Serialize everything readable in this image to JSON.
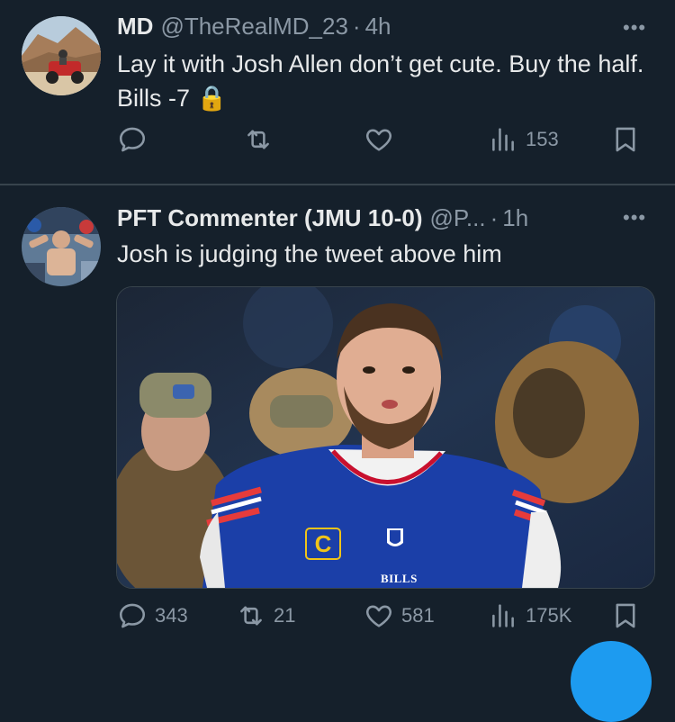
{
  "tweets": [
    {
      "name": "MD",
      "handle": "@TheRealMD_23",
      "separator": "·",
      "time": "4h",
      "text": "Lay it with Josh Allen don’t get cute. Buy the half. Bills -7 🔒",
      "actions": {
        "replies": "",
        "retweets": "",
        "likes": "",
        "views": "153"
      }
    },
    {
      "name": "PFT Commenter (JMU 10-0)",
      "handle": "@P...",
      "separator": "·",
      "time": "1h",
      "text": "Josh is judging the tweet above him",
      "media": {
        "jersey_text": "BILLS"
      },
      "actions": {
        "replies": "343",
        "retweets": "21",
        "likes": "581",
        "views": "175K"
      }
    }
  ],
  "more_label": "•••",
  "colors": {
    "background": "#15202b",
    "secondary_text": "#8b98a5",
    "divider": "#38444d",
    "accent": "#1d9bf0"
  }
}
